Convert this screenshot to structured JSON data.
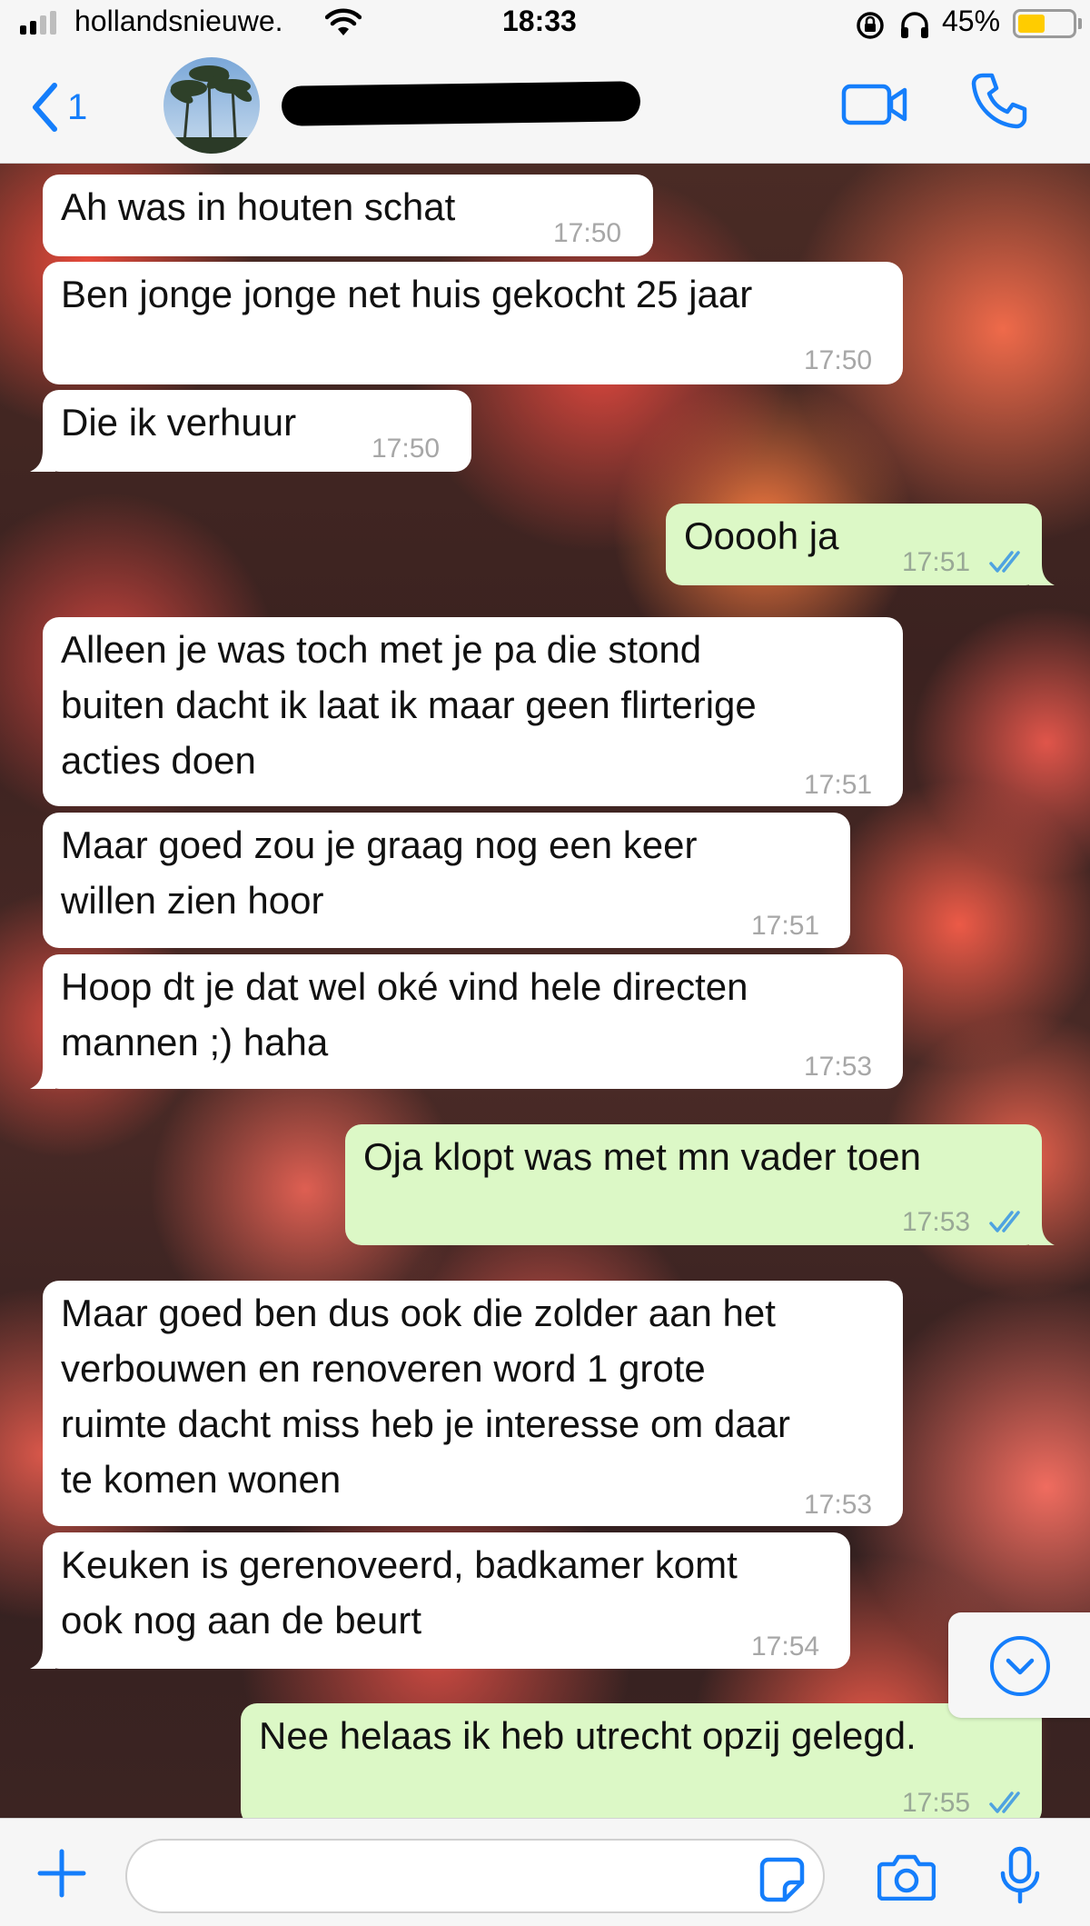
{
  "status_bar": {
    "carrier": "hollandsnieuwe.",
    "time": "18:33",
    "battery_percent": "45%",
    "battery_level": 0.45,
    "icons": [
      "signal-icon",
      "wifi-icon",
      "orientation-lock-icon",
      "headphones-icon",
      "battery-icon"
    ]
  },
  "header": {
    "back_count": "1",
    "icons": [
      "back-chevron-icon",
      "video-call-icon",
      "phone-call-icon"
    ]
  },
  "messages": [
    {
      "direction": "in",
      "text": "Ah was in houten schat",
      "time": "17:50"
    },
    {
      "direction": "in",
      "text": "Ben jonge jonge net huis gekocht 25 jaar",
      "time": "17:50"
    },
    {
      "direction": "in",
      "text": "Die ik verhuur",
      "time": "17:50"
    },
    {
      "direction": "out",
      "text": "Ooooh ja",
      "time": "17:51",
      "status": "read"
    },
    {
      "direction": "in",
      "text": "Alleen je was toch met je pa die stond\nbuiten dacht ik laat ik maar geen flirterige\nacties doen",
      "time": "17:51"
    },
    {
      "direction": "in",
      "text": "Maar goed zou je graag nog een keer\nwillen zien hoor",
      "time": "17:51"
    },
    {
      "direction": "in",
      "text": "Hoop dt je dat wel oké vind hele directen\nmannen ;) haha",
      "time": "17:53"
    },
    {
      "direction": "out",
      "text": "Oja klopt was met mn vader toen",
      "time": "17:53",
      "status": "read"
    },
    {
      "direction": "in",
      "text": "Maar goed ben dus ook die zolder aan het\nverbouwen en renoveren word 1 grote\nruimte dacht miss heb je interesse om daar\nte komen wonen",
      "time": "17:53"
    },
    {
      "direction": "in",
      "text": "Keuken is gerenoveerd, badkamer komt\nook nog aan de beurt",
      "time": "17:54"
    },
    {
      "direction": "out",
      "text": "Nee helaas ik heb utrecht opzij gelegd.",
      "time": "17:55",
      "status": "read"
    }
  ],
  "colors": {
    "accent": "#157efb",
    "incoming_bubble": "#ffffff",
    "outgoing_bubble": "#dcf8c6",
    "read_ticks": "#4fa3e0"
  },
  "composer": {
    "input_value": "",
    "icons": [
      "plus-icon",
      "sticker-icon",
      "camera-icon",
      "microphone-icon"
    ]
  },
  "scroll_button_icon": "chevron-down-circle-icon"
}
